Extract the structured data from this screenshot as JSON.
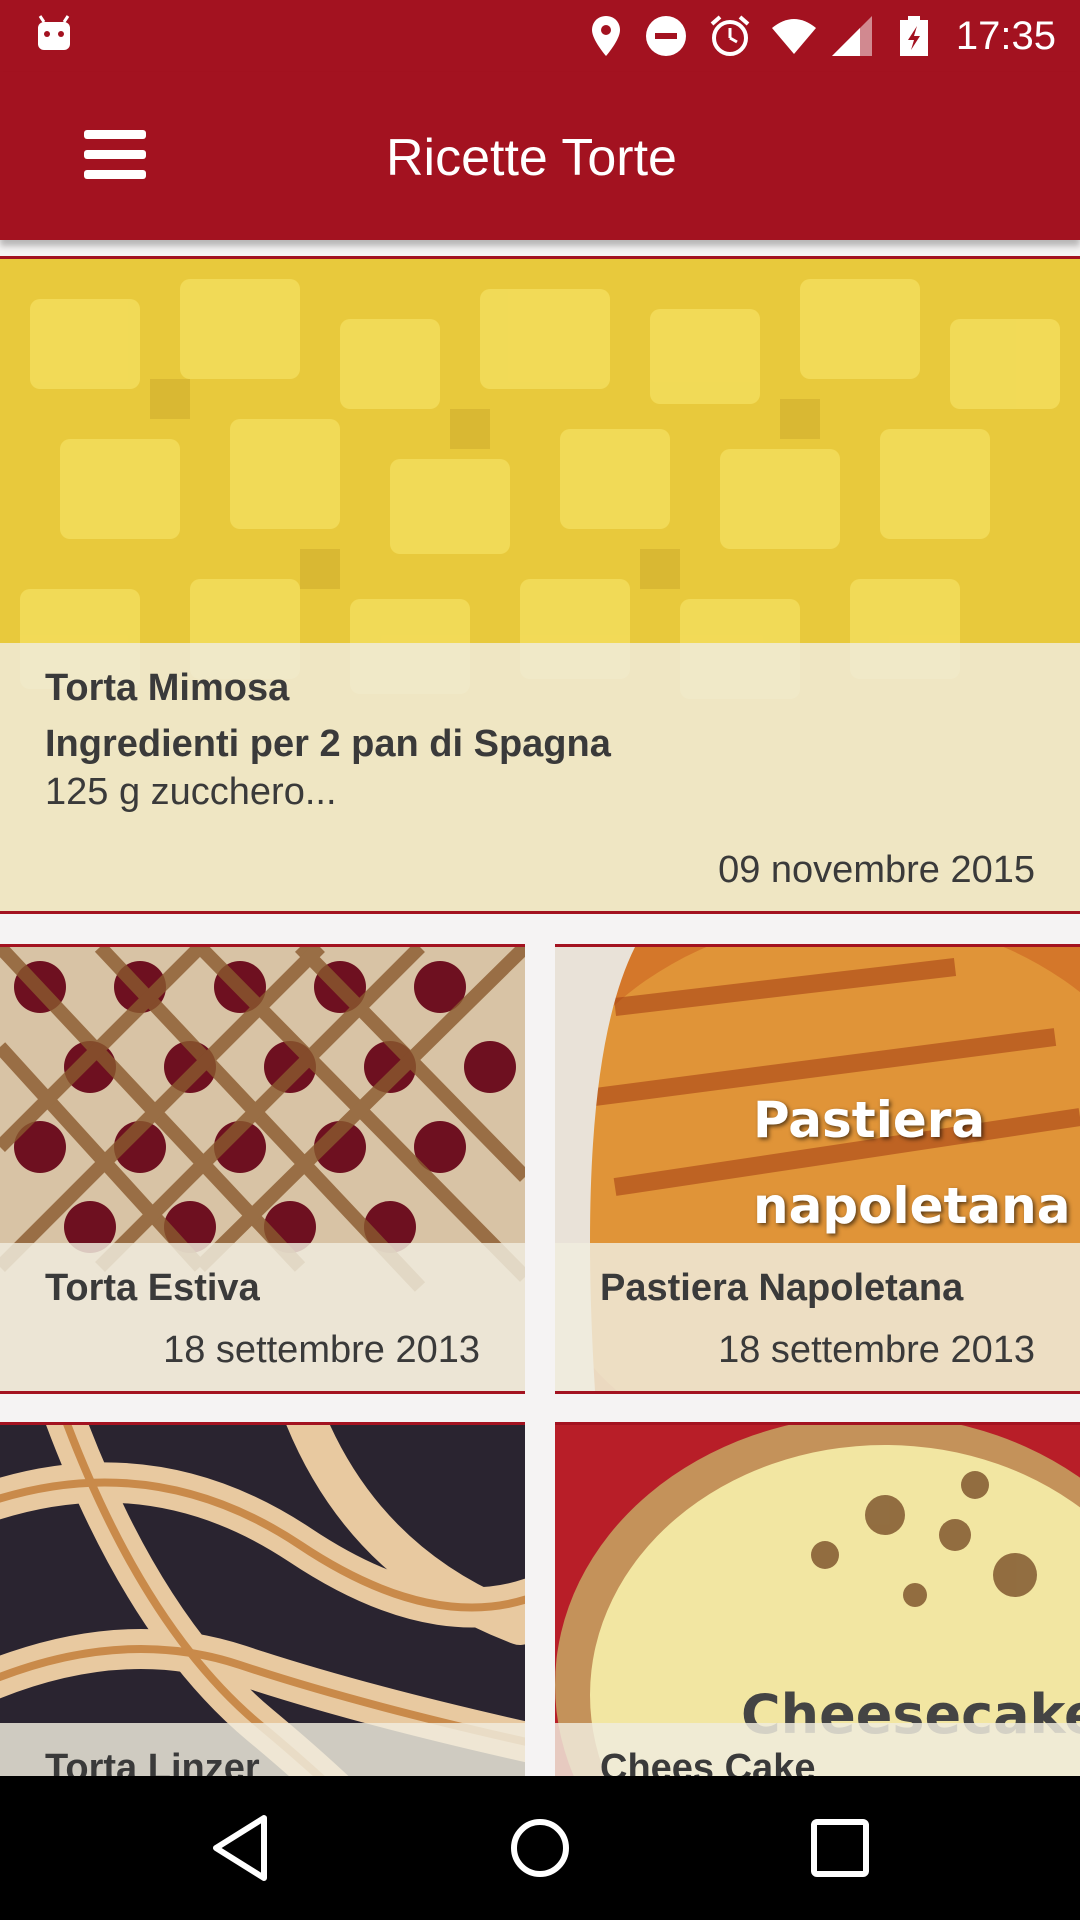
{
  "status_bar": {
    "time": "17:35",
    "icons": [
      "android-icon",
      "location-icon",
      "do-not-disturb-icon",
      "alarm-icon",
      "wifi-icon",
      "signal-icon",
      "battery-charging-icon"
    ]
  },
  "app_bar": {
    "title": "Ricette Torte",
    "menu_icon": "hamburger-menu-icon"
  },
  "featured": {
    "title": "Torta Mimosa",
    "subtitle": "Ingredienti per 2 pan di Spagna",
    "excerpt": "125 g zucchero...",
    "date": "09 novembre 2015"
  },
  "recipes": [
    {
      "title": "Torta Estiva",
      "date": "18 settembre 2013"
    },
    {
      "title": "Pastiera Napoletana",
      "date": "18 settembre 2013",
      "photo_text_1": "Pastiera",
      "photo_text_2": "napoletana"
    },
    {
      "title": "Torta Linzer",
      "date": ""
    },
    {
      "title": "Chees Cake",
      "date": "",
      "photo_text_1": "Cheesecake"
    }
  ],
  "nav_bar": {
    "buttons": [
      "back-icon",
      "home-icon",
      "recents-icon"
    ]
  },
  "colors": {
    "primary": "#a31220",
    "background": "#f5f3f3",
    "overlay": "#f0ecde"
  }
}
